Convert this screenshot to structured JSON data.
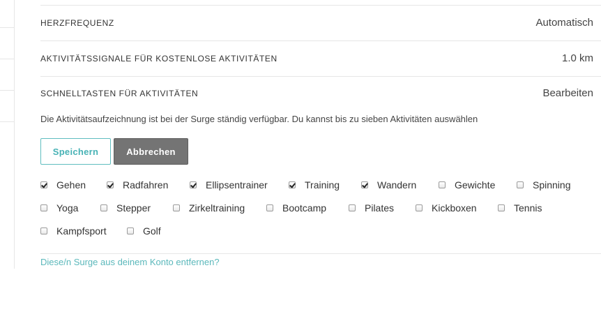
{
  "settings": {
    "heart_rate": {
      "label": "HERZFREQUENZ",
      "value": "Automatisch"
    },
    "activity_signals": {
      "label": "AKTIVITÄTSSIGNALE FÜR KOSTENLOSE AKTIVITÄTEN",
      "value": "1.0 km"
    },
    "shortcuts": {
      "label": "SCHNELLTASTEN FÜR AKTIVITÄTEN",
      "edit_label": "Bearbeiten",
      "description": "Die Aktivitätsaufzeichnung ist bei der Surge ständig verfügbar. Du kannst bis zu sieben Aktivitäten auswählen",
      "save_label": "Speichern",
      "cancel_label": "Abbrechen",
      "activities": [
        {
          "label": "Gehen",
          "checked": true
        },
        {
          "label": "Radfahren",
          "checked": true
        },
        {
          "label": "Ellipsentrainer",
          "checked": true
        },
        {
          "label": "Training",
          "checked": true
        },
        {
          "label": "Wandern",
          "checked": true
        },
        {
          "label": "Gewichte",
          "checked": false
        },
        {
          "label": "Spinning",
          "checked": false
        },
        {
          "label": "Yoga",
          "checked": false
        },
        {
          "label": "Stepper",
          "checked": false
        },
        {
          "label": "Zirkeltraining",
          "checked": false
        },
        {
          "label": "Bootcamp",
          "checked": false
        },
        {
          "label": "Pilates",
          "checked": false
        },
        {
          "label": "Kickboxen",
          "checked": false
        },
        {
          "label": "Tennis",
          "checked": false
        },
        {
          "label": "Kampfsport",
          "checked": false
        },
        {
          "label": "Golf",
          "checked": false
        }
      ]
    },
    "remove_link": "Diese/n Surge aus deinem Konto entfernen?"
  },
  "colors": {
    "accent": "#47b2b5",
    "cancel_bg": "#747474",
    "divider": "#e6e6e6"
  }
}
